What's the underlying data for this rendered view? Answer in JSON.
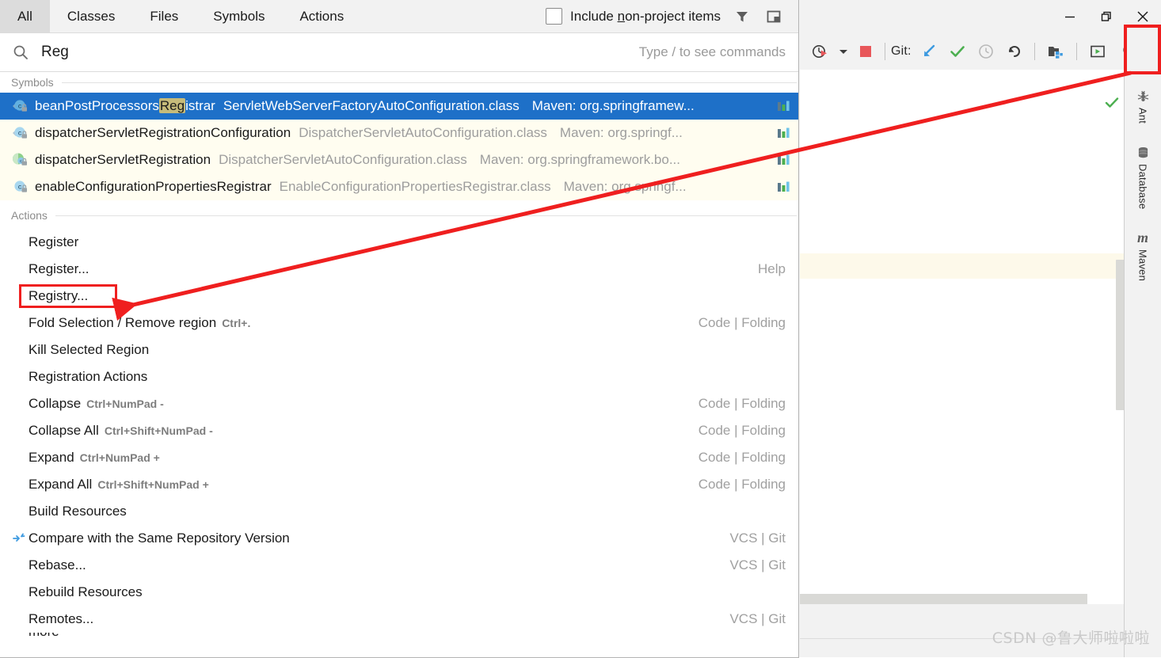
{
  "window": {
    "controls": [
      {
        "name": "minimize",
        "glyph": "minimize-icon"
      },
      {
        "name": "restore",
        "glyph": "restore-icon"
      },
      {
        "name": "close",
        "glyph": "close-icon"
      }
    ]
  },
  "toolbar": {
    "git_label": "Git:",
    "items": [
      {
        "name": "run-with-profiler-icon",
        "title": "Run with Profiler"
      },
      {
        "name": "dropdown-arrow-icon",
        "title": "Open dropdown"
      },
      {
        "name": "stop-icon",
        "title": "Stop"
      },
      {
        "name": "update-project-icon",
        "title": "Update Project"
      },
      {
        "name": "commit-icon",
        "title": "Commit"
      },
      {
        "name": "history-icon",
        "title": "Show History"
      },
      {
        "name": "rollback-icon",
        "title": "Rollback"
      },
      {
        "name": "project-structure-icon",
        "title": "Project Structure"
      },
      {
        "name": "run-anything-icon",
        "title": "Run Anything"
      },
      {
        "name": "search-everywhere-icon",
        "title": "Search Everywhere"
      }
    ]
  },
  "right_stripe": {
    "items": [
      {
        "label": "Ant",
        "icon": "ant-icon"
      },
      {
        "label": "Database",
        "icon": "database-icon"
      },
      {
        "label": "Maven",
        "icon": "maven-icon"
      }
    ]
  },
  "popup": {
    "tabs": [
      {
        "label": "All",
        "active": true
      },
      {
        "label": "Classes",
        "active": false
      },
      {
        "label": "Files",
        "active": false
      },
      {
        "label": "Symbols",
        "active": false
      },
      {
        "label": "Actions",
        "active": false
      }
    ],
    "include_non_project": {
      "label_before": "Include ",
      "label_mnemonic": "n",
      "label_after": "on-project items",
      "checked": false
    },
    "header_icons": [
      {
        "name": "filter-icon"
      },
      {
        "name": "preview-panel-icon"
      }
    ],
    "search": {
      "icon": "search-icon",
      "value": "Reg",
      "placeholder": "Type / to see commands",
      "hint": "Type / to see commands"
    },
    "sections": [
      {
        "title": "Symbols"
      },
      {
        "title": "Actions"
      }
    ],
    "symbol_results": [
      {
        "icon": "class-locked-icon",
        "name_pre": "beanPostProcessors",
        "name_match": "Reg",
        "name_post": "istrar",
        "file": "ServletWebServerFactoryAutoConfiguration.class",
        "module": "Maven: org.springframew...",
        "right_icon": "module-library-icon",
        "selected": true
      },
      {
        "icon": "class-locked-icon",
        "name_pre": "dispatcherServletRegistrationConfiguration",
        "name_match": "",
        "name_post": "",
        "file": "DispatcherServletAutoConfiguration.class",
        "module": "Maven: org.springf...",
        "right_icon": "module-library-icon",
        "selected": false
      },
      {
        "icon": "method-locked-icon",
        "name_pre": "dispatcherServletRegistration",
        "name_match": "",
        "name_post": "",
        "file": "DispatcherServletAutoConfiguration.class",
        "module": "Maven: org.springframework.bo...",
        "right_icon": "module-library-icon",
        "selected": false
      },
      {
        "icon": "class-locked-icon",
        "name_pre": "enableConfigurationPropertiesRegistrar",
        "name_match": "",
        "name_post": "",
        "file": "EnableConfigurationPropertiesRegistrar.class",
        "module": "Maven: org.springf...",
        "right_icon": "module-library-icon",
        "selected": false
      }
    ],
    "action_results": [
      {
        "label": "Register",
        "shortcut": "",
        "group": "",
        "icon": "",
        "highlighted": false
      },
      {
        "label": "Register...",
        "shortcut": "",
        "group": "Help",
        "icon": "",
        "highlighted": false
      },
      {
        "label": "Registry...",
        "shortcut": "",
        "group": "",
        "icon": "",
        "highlighted": true
      },
      {
        "label": "Fold Selection / Remove region",
        "shortcut": "Ctrl+.",
        "group": "Code | Folding",
        "icon": "",
        "highlighted": false
      },
      {
        "label": "Kill Selected Region",
        "shortcut": "",
        "group": "",
        "icon": "",
        "highlighted": false
      },
      {
        "label": "Registration Actions",
        "shortcut": "",
        "group": "",
        "icon": "",
        "highlighted": false
      },
      {
        "label": "Collapse",
        "shortcut": "Ctrl+NumPad -",
        "group": "Code | Folding",
        "icon": "",
        "highlighted": false
      },
      {
        "label": "Collapse All",
        "shortcut": "Ctrl+Shift+NumPad -",
        "group": "Code | Folding",
        "icon": "",
        "highlighted": false
      },
      {
        "label": "Expand",
        "shortcut": "Ctrl+NumPad +",
        "group": "Code | Folding",
        "icon": "",
        "highlighted": false
      },
      {
        "label": "Expand All",
        "shortcut": "Ctrl+Shift+NumPad +",
        "group": "Code | Folding",
        "icon": "",
        "highlighted": false
      },
      {
        "label": "Build Resources",
        "shortcut": "",
        "group": "",
        "icon": "",
        "highlighted": false
      },
      {
        "label": "Compare with the Same Repository Version",
        "shortcut": "",
        "group": "VCS | Git",
        "icon": "compare-icon",
        "highlighted": false
      },
      {
        "label": "Rebase...",
        "shortcut": "",
        "group": "VCS | Git",
        "icon": "",
        "highlighted": false
      },
      {
        "label": "Rebuild Resources",
        "shortcut": "",
        "group": "",
        "icon": "",
        "highlighted": false
      },
      {
        "label": "Remotes...",
        "shortcut": "",
        "group": "VCS | Git",
        "icon": "",
        "highlighted": false
      }
    ],
    "clipped_row": {
      "label": "more"
    }
  },
  "annotations": {
    "search_button_box": {
      "name": "search-everywhere-highlight"
    },
    "registry_box": {
      "name": "registry-item-highlight"
    },
    "arrow": {
      "name": "pointer-arrow",
      "color": "#ef1f1f"
    }
  },
  "watermark": {
    "text": "CSDN @鲁大师啦啦啦"
  },
  "colors": {
    "accent_selection": "#1e70c8",
    "match_highlight": "#c6bb7a",
    "annotation_red": "#ef1f1f",
    "result_bg": "#fffdf0",
    "chrome_bg": "#f2f2f2"
  }
}
